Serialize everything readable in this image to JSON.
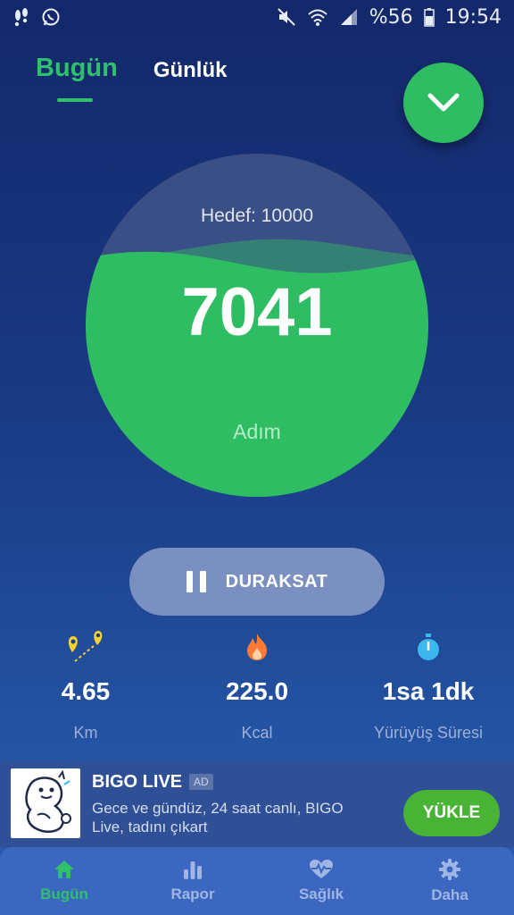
{
  "status_bar": {
    "battery_percent": "%56",
    "time": "19:54",
    "icons_left": [
      "steps-icon",
      "whatsapp-icon"
    ],
    "icons_right": [
      "mute-icon",
      "wifi-icon",
      "signal-icon",
      "battery-icon"
    ]
  },
  "tabs": [
    {
      "label": "Bugün",
      "active": true
    },
    {
      "label": "Günlük",
      "active": false
    }
  ],
  "gauge": {
    "goal_text": "Hedef: 10000",
    "steps": "7041",
    "steps_label": "Adım",
    "progress": 0.7041,
    "fill_color": "#2ebd62",
    "track_color": "#3a4f86"
  },
  "pause_button": {
    "label": "DURAKSAT"
  },
  "stats": [
    {
      "icon": "distance-icon",
      "value": "4.65",
      "label": "Km",
      "color": "#f5d22d"
    },
    {
      "icon": "flame-icon",
      "value": "225.0",
      "label": "Kcal",
      "color": "#ff7a33"
    },
    {
      "icon": "stopwatch-icon",
      "value": "1sa 1dk",
      "label": "Yürüyüş Süresi",
      "color": "#3cb8f0"
    }
  ],
  "ad": {
    "title": "BIGO LIVE",
    "badge": "AD",
    "description": "Gece ve gündüz, 24 saat canlı, BIGO Live, tadını çıkart",
    "cta": "YÜKLE"
  },
  "bottom_nav": [
    {
      "label": "Bugün",
      "icon": "home-icon",
      "active": true
    },
    {
      "label": "Rapor",
      "icon": "bar-chart-icon",
      "active": false
    },
    {
      "label": "Sağlık",
      "icon": "heart-pulse-icon",
      "active": false
    },
    {
      "label": "Daha",
      "icon": "gear-icon",
      "active": false
    }
  ],
  "colors": {
    "accent": "#2ec06a",
    "background_top": "#13286a",
    "background_bottom": "#2a5fb0"
  }
}
